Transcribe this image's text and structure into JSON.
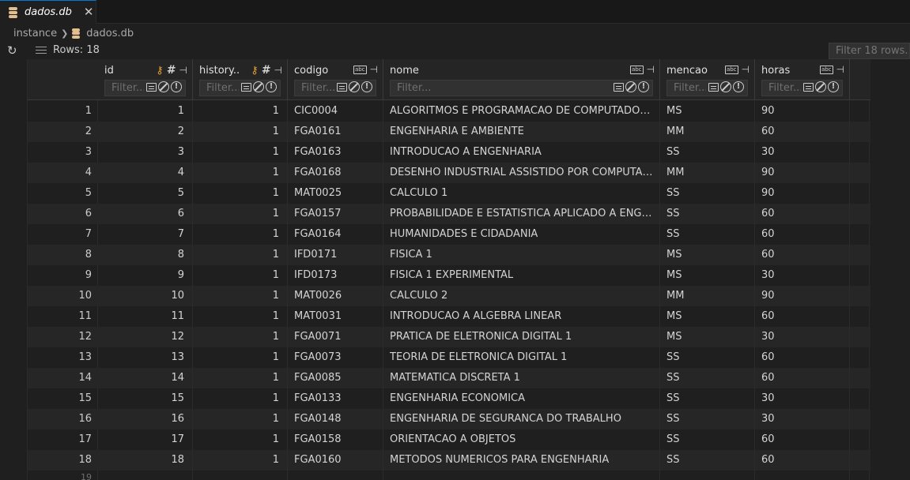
{
  "tab": {
    "label": "dados.db",
    "close": "✕"
  },
  "breadcrumb": {
    "root": "instance",
    "file": "dados.db"
  },
  "toolbar": {
    "refresh": "↻",
    "rows_label": "Rows: 18",
    "filter_placeholder": "Filter 18 rows..."
  },
  "columns": [
    {
      "name": "id",
      "type": "number",
      "key": true,
      "filter_placeholder": "Filter..."
    },
    {
      "name": "history...",
      "type": "number",
      "key": true,
      "filter_placeholder": "Filter..."
    },
    {
      "name": "codigo",
      "type": "text",
      "key": false,
      "filter_placeholder": "Filter..."
    },
    {
      "name": "nome",
      "type": "text",
      "key": false,
      "filter_placeholder": "Filter..."
    },
    {
      "name": "mencao",
      "type": "text",
      "key": false,
      "filter_placeholder": "Filter..."
    },
    {
      "name": "horas",
      "type": "text",
      "key": false,
      "filter_placeholder": "Filter..."
    }
  ],
  "rows": [
    {
      "n": "1",
      "id": "1",
      "hist": "1",
      "codigo": "CIC0004",
      "nome": "ALGORITMOS E PROGRAMACAO DE COMPUTADORES",
      "mencao": "MS",
      "horas": "90"
    },
    {
      "n": "2",
      "id": "2",
      "hist": "1",
      "codigo": "FGA0161",
      "nome": "ENGENHARIA E AMBIENTE",
      "mencao": "MM",
      "horas": "60"
    },
    {
      "n": "3",
      "id": "3",
      "hist": "1",
      "codigo": "FGA0163",
      "nome": "INTRODUCAO A ENGENHARIA",
      "mencao": "SS",
      "horas": "30"
    },
    {
      "n": "4",
      "id": "4",
      "hist": "1",
      "codigo": "FGA0168",
      "nome": "DESENHO INDUSTRIAL ASSISTIDO POR COMPUTADOR",
      "mencao": "MM",
      "horas": "90"
    },
    {
      "n": "5",
      "id": "5",
      "hist": "1",
      "codigo": "MAT0025",
      "nome": "CALCULO 1",
      "mencao": "SS",
      "horas": "90"
    },
    {
      "n": "6",
      "id": "6",
      "hist": "1",
      "codigo": "FGA0157",
      "nome": "PROBABILIDADE E ESTATISTICA APLICADO A ENGENHA...",
      "mencao": "SS",
      "horas": "60"
    },
    {
      "n": "7",
      "id": "7",
      "hist": "1",
      "codigo": "FGA0164",
      "nome": "HUMANIDADES E CIDADANIA",
      "mencao": "SS",
      "horas": "60"
    },
    {
      "n": "8",
      "id": "8",
      "hist": "1",
      "codigo": "IFD0171",
      "nome": "FISICA 1",
      "mencao": "MS",
      "horas": "60"
    },
    {
      "n": "9",
      "id": "9",
      "hist": "1",
      "codigo": "IFD0173",
      "nome": "FISICA 1 EXPERIMENTAL",
      "mencao": "MS",
      "horas": "30"
    },
    {
      "n": "10",
      "id": "10",
      "hist": "1",
      "codigo": "MAT0026",
      "nome": "CALCULO 2",
      "mencao": "MM",
      "horas": "90"
    },
    {
      "n": "11",
      "id": "11",
      "hist": "1",
      "codigo": "MAT0031",
      "nome": "INTRODUCAO A ALGEBRA LINEAR",
      "mencao": "MS",
      "horas": "60"
    },
    {
      "n": "12",
      "id": "12",
      "hist": "1",
      "codigo": "FGA0071",
      "nome": "PRATICA DE ELETRONICA DIGITAL 1",
      "mencao": "MS",
      "horas": "30"
    },
    {
      "n": "13",
      "id": "13",
      "hist": "1",
      "codigo": "FGA0073",
      "nome": "TEORIA DE ELETRONICA DIGITAL 1",
      "mencao": "SS",
      "horas": "60"
    },
    {
      "n": "14",
      "id": "14",
      "hist": "1",
      "codigo": "FGA0085",
      "nome": "MATEMATICA DISCRETA 1",
      "mencao": "SS",
      "horas": "60"
    },
    {
      "n": "15",
      "id": "15",
      "hist": "1",
      "codigo": "FGA0133",
      "nome": "ENGENHARIA ECONOMICA",
      "mencao": "SS",
      "horas": "30"
    },
    {
      "n": "16",
      "id": "16",
      "hist": "1",
      "codigo": "FGA0148",
      "nome": "ENGENHARIA DE SEGURANCA DO TRABALHO",
      "mencao": "SS",
      "horas": "30"
    },
    {
      "n": "17",
      "id": "17",
      "hist": "1",
      "codigo": "FGA0158",
      "nome": "ORIENTACAO A OBJETOS",
      "mencao": "SS",
      "horas": "60"
    },
    {
      "n": "18",
      "id": "18",
      "hist": "1",
      "codigo": "FGA0160",
      "nome": "METODOS NUMERICOS PARA ENGENHARIA",
      "mencao": "SS",
      "horas": "60"
    }
  ],
  "partial_next_row": "19",
  "icons": {
    "tab": "database-icon",
    "key": "key-icon",
    "number_type": "hash-icon",
    "text_type": "abc-icon",
    "pin": "pin-icon",
    "refresh": "refresh-icon"
  },
  "colors": {
    "accent": "#0078d4",
    "key": "#e8a135",
    "db": "#e2c08d"
  }
}
